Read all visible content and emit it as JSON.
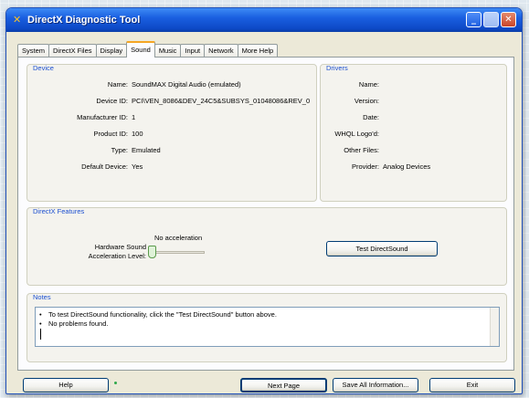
{
  "window": {
    "title": "DirectX Diagnostic Tool"
  },
  "tabs": [
    {
      "label": "System"
    },
    {
      "label": "DirectX Files"
    },
    {
      "label": "Display"
    },
    {
      "label": "Sound"
    },
    {
      "label": "Music"
    },
    {
      "label": "Input"
    },
    {
      "label": "Network"
    },
    {
      "label": "More Help"
    }
  ],
  "active_tab": "Sound",
  "device": {
    "title": "Device",
    "rows": [
      {
        "label": "Name:",
        "value": "SoundMAX Digital Audio (emulated)"
      },
      {
        "label": "Device ID:",
        "value": "PCI\\VEN_8086&DEV_24C5&SUBSYS_01048086&REV_0"
      },
      {
        "label": "Manufacturer ID:",
        "value": "1"
      },
      {
        "label": "Product ID:",
        "value": "100"
      },
      {
        "label": "Type:",
        "value": "Emulated"
      },
      {
        "label": "Default Device:",
        "value": "Yes"
      }
    ]
  },
  "drivers": {
    "title": "Drivers",
    "rows": [
      {
        "label": "Name:",
        "value": ""
      },
      {
        "label": "Version:",
        "value": ""
      },
      {
        "label": "Date:",
        "value": ""
      },
      {
        "label": "WHQL Logo'd:",
        "value": ""
      },
      {
        "label": "Other Files:",
        "value": ""
      },
      {
        "label": "Provider:",
        "value": "Analog Devices"
      }
    ]
  },
  "features": {
    "title": "DirectX Features",
    "hw_label_1": "Hardware Sound",
    "hw_label_2": "Acceleration Level:",
    "slider_value": "No acceleration",
    "slider_level": 0,
    "test_button": "Test DirectSound"
  },
  "notes": {
    "title": "Notes",
    "items": [
      "To test DirectSound functionality, click the \"Test DirectSound\" button above.",
      "No problems found."
    ]
  },
  "footer": {
    "help": "Help",
    "next_page": "Next Page",
    "save_all": "Save All Information...",
    "exit": "Exit"
  }
}
